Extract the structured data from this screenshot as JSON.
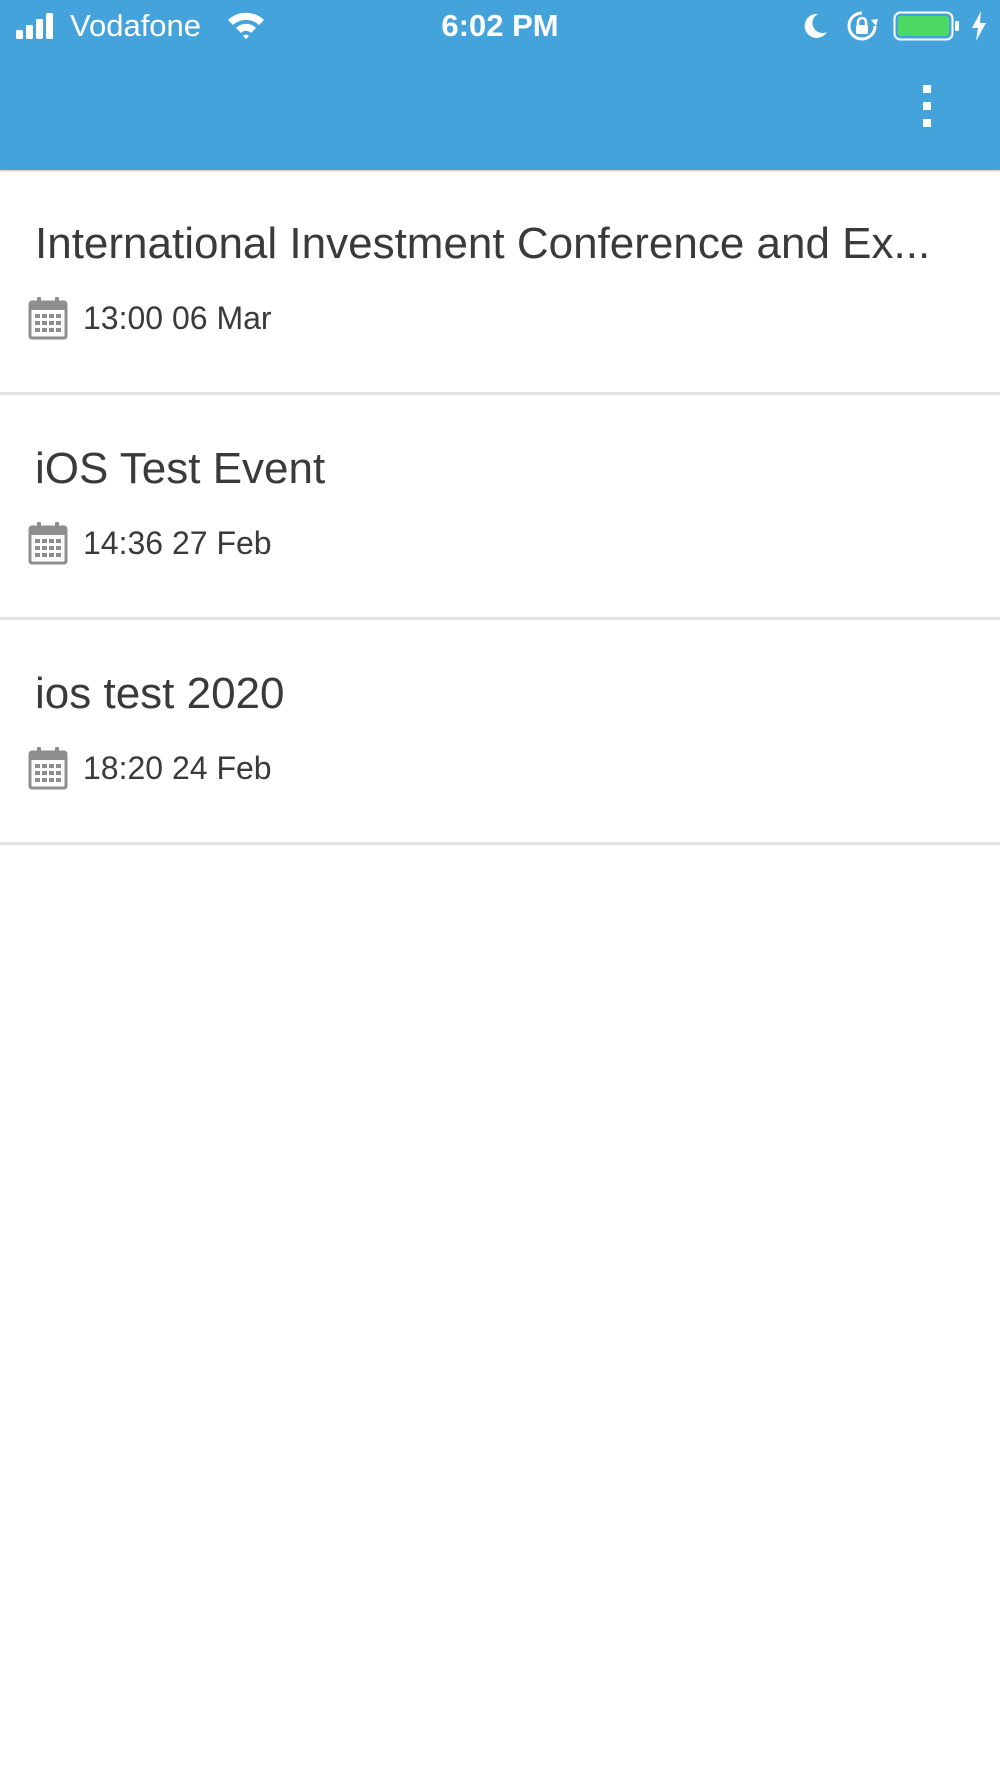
{
  "status_bar": {
    "carrier": "Vodafone",
    "time": "6:02 PM",
    "battery_color": "#4cd964",
    "icons": [
      "signal-icon",
      "wifi-icon",
      "moon-icon",
      "orientation-lock-icon",
      "battery-icon",
      "charging-icon"
    ]
  },
  "app_bar": {
    "background_color": "#45a3db",
    "menu_icon": "more-vertical-icon"
  },
  "events": [
    {
      "title": "International Investment Conference and Ex...",
      "datetime": "13:00 06 Mar",
      "icon": "calendar-icon"
    },
    {
      "title": "iOS Test Event",
      "datetime": "14:36 27 Feb",
      "icon": "calendar-icon"
    },
    {
      "title": "ios test 2020",
      "datetime": "18:20 24 Feb",
      "icon": "calendar-icon"
    }
  ]
}
